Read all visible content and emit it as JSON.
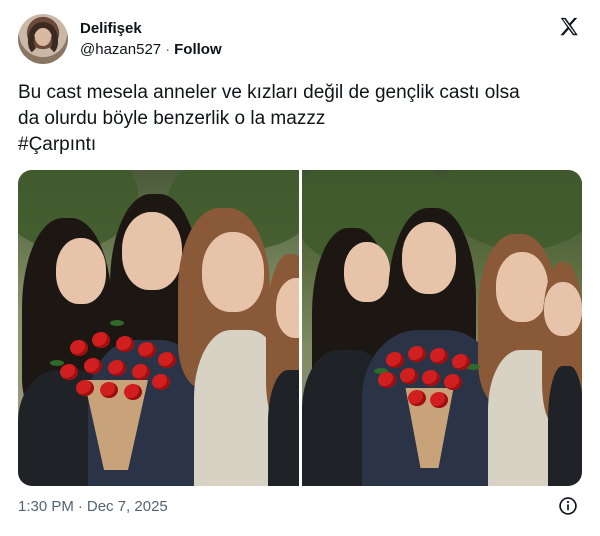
{
  "author": {
    "display_name": "Delifişek",
    "handle": "@hazan527",
    "separator": "·",
    "follow_label": "Follow"
  },
  "tweet": {
    "lines": [
      "Bu cast mesela anneler ve kızları değil de gençlik castı olsa",
      "da olurdu böyle benzerlik o la mazzz",
      "#Çarpıntı"
    ]
  },
  "media": {
    "count": 2,
    "items": [
      "photo-group-left",
      "photo-group-right"
    ]
  },
  "footer": {
    "time": "1:30 PM",
    "separator": "·",
    "date": "Dec 7, 2025"
  },
  "icons": {
    "brand": "x-logo-icon",
    "info": "info-icon"
  },
  "colors": {
    "text": "#0f1419",
    "secondary": "#536471",
    "background": "#ffffff"
  }
}
